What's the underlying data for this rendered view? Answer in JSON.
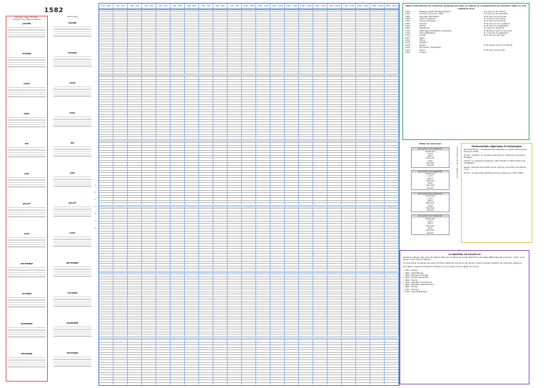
{
  "calendar": {
    "year": "1582",
    "left_header": [
      "Espagne, Italie, Portugal,",
      "Pologne (voir table de Gauss)"
    ],
    "mid_header": [
      "autres pays"
    ],
    "months_left": [
      "JANVIER",
      "FÉVRIER",
      "MARS",
      "AVRIL",
      "MAI",
      "JUIN",
      "JUILLET",
      "AOÛT",
      "SEPTEMBRE",
      "OCTOBRE",
      "NOVEMBRE",
      "DÉCEMBRE"
    ],
    "months_mid": [
      "JANVIER",
      "FÉVRIER",
      "MARS",
      "AVRIL",
      "MAI",
      "JUIN",
      "JUILLET",
      "AOÛT",
      "SEPTEMBRE",
      "OCTOBRE",
      "NOVEMBRE",
      "DÉCEMBRE"
    ],
    "nav_letters": [
      "A",
      "B",
      "C",
      "D",
      "E",
      "F",
      "G"
    ]
  },
  "tables": {
    "column_headers": [
      "001 - 099",
      "100 - 199",
      "200 - 299",
      "300 - 399",
      "400 - 499",
      "500 - 599",
      "600 - 699",
      "700 - 799",
      "800 - 899",
      "900 - 999",
      "1000 - 1099",
      "1100 - 1199",
      "1200 - 1299",
      "1300 - 1399",
      "1400 - 1499",
      "1500 - 1599",
      "1600 - 1699",
      "1700 - 1799",
      "1800 - 1899",
      "1900 - 1999",
      "2000 - 2099"
    ]
  },
  "countries": {
    "title": "Dates d'introduction du calendrier grégorien par pays ou régions en remplacement du calendrier julien ou d'un calendrier local",
    "rows": [
      [
        "1582",
        "Espagne, Italie, Portugal, Pologne",
        "le 4 suivi du 15 octobre"
      ],
      [
        "1582",
        "France (Lorraine en 1760)",
        "le 9 suivi du 20 décembre"
      ],
      [
        "1583",
        "Pays-Bas catholiques",
        "le 21 suivi du 1er janvier"
      ],
      [
        "1583",
        "Autriche, Bavière",
        "le 5 suivi du 16 octobre"
      ],
      [
        "1584",
        "Suisse catholique",
        "le 11 suivi du 22 janvier"
      ],
      [
        "1587",
        "Hongrie",
        "le 21 suivi du 1er novembre"
      ],
      [
        "1610",
        "Prusse",
        "le 22 suivi du 2 septembre"
      ],
      [
        "1682",
        "Strasbourg",
        "le 5 suivi du 16 février"
      ],
      [
        "1700",
        "Allemagne protestante, Danemark",
        "le 18 février suivi du 1er mars"
      ],
      [
        "1752",
        "Grande-Bretagne",
        "le 2 suivi du 14 septembre"
      ],
      [
        "1753",
        "Suède",
        "le 17 suivi du 1er mars"
      ],
      [
        "1873",
        "Japon",
        ""
      ],
      [
        "1912",
        "Chine",
        ""
      ],
      [
        "1916",
        "Bulgarie",
        ""
      ],
      [
        "1918",
        "Russie",
        "le 31 janvier suivi du 14 février"
      ],
      [
        "1919",
        "Roumanie, Yougoslavie",
        ""
      ],
      [
        "1923",
        "Grèce",
        "le 15 suivi du 1er mars"
      ],
      [
        "1926",
        "Turquie",
        ""
      ]
    ]
  },
  "concordance": {
    "title": "Tables de conversion",
    "headers": [
      "Jour julien",
      "Jour grégorien"
    ],
    "days": [
      "Dimanche",
      "Lundi",
      "Mardi",
      "Mercredi",
      "Jeudi",
      "Vendredi",
      "Samedi"
    ]
  },
  "rotated_label": "Calendrier julien / grégorien",
  "particular": {
    "title": "Particularités régionales et historiques",
    "paragraphs": [
      "Nouvelle-France : changement de calendrier en même temps que la France en 1582.",
      "Écosse : adoption du nouveau calendrier en 1752 avec la Grande-Bretagne.",
      "Irlande : le calendrier grégorien a été adopté en même temps que l'Angleterre.",
      "Suède : période de transition entre 1700 et 1712 avec le 30 février 1712.",
      "France : le calendrier républicain fut en vigueur de 1793 à 1805."
    ]
  },
  "question": {
    "title": "La question du nouvel an",
    "paragraphs": [
      "Pendant le Moyen Âge, dans les régions d'Europe, le début de l'année était fixé à des dates différentes selon les lieux : Noël, le 1er janvier, le 25 mars ou Pâques.",
      "Au XVIe siècle, la plupart des pays ont fixé le début de l'année au 1er janvier, avant ou après l'adoption du calendrier grégorien.",
      "Les dates ci-dessous indiquent l'adoption du 1er janvier comme début de l'année :"
    ],
    "list": [
      "1522 : Venise",
      "1544 : Saint-Empire",
      "1556 : Espagne, Portugal",
      "1559 : Prusse, Danemark",
      "1564 : France",
      "1576 : Pays-Bas méridionaux",
      "1583 : Pays-Bas septentrionaux",
      "1600 : Écosse",
      "1721 : Toscane",
      "1752 : Grande-Bretagne"
    ]
  }
}
